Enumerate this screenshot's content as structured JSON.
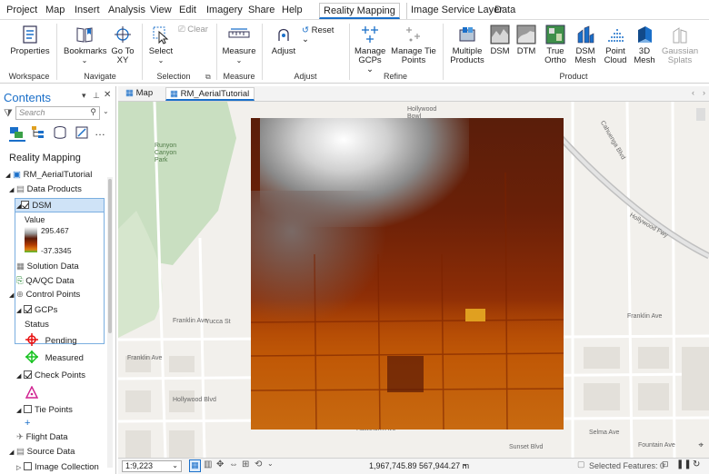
{
  "menu": {
    "tabs": [
      "Project",
      "Map",
      "Insert",
      "Analysis",
      "View",
      "Edit",
      "Imagery",
      "Share",
      "Help"
    ],
    "context_tab": "Reality Mapping",
    "extra_tabs": [
      "Image Service Layer",
      "Data"
    ]
  },
  "ribbon": {
    "workspace": {
      "group": "Workspace",
      "properties": "Properties"
    },
    "navigate": {
      "group": "Navigate",
      "bookmarks": "Bookmarks",
      "goto": "Go To XY"
    },
    "selection": {
      "group": "Selection",
      "select": "Select",
      "clear": "Clear"
    },
    "measure": {
      "group": "Measure",
      "measure": "Measure"
    },
    "adjust": {
      "group": "Adjust",
      "adjust": "Adjust",
      "reset": "Reset"
    },
    "refine": {
      "group": "Refine",
      "manage_gcps": "Manage GCPs",
      "manage_tie": "Manage Tie Points"
    },
    "product": {
      "group": "Product",
      "items": [
        "Multiple Products",
        "DSM",
        "DTM",
        "True Ortho",
        "DSM Mesh",
        "Point Cloud",
        "3D Mesh",
        "Gaussian Splats"
      ]
    }
  },
  "contents": {
    "title": "Contents",
    "search_placeholder": "Search",
    "heading": "Reality Mapping",
    "workspace": "RM_AerialTutorial",
    "data_products": "Data Products",
    "dsm": "DSM",
    "legend": {
      "label": "Value",
      "max": "295.467",
      "min": "-37.3345"
    },
    "solution_data": "Solution Data",
    "qaqc": "QA/QC Data",
    "control_points": "Control Points",
    "gcps": "GCPs",
    "status": "Status",
    "pending": "Pending",
    "measured": "Measured",
    "check_points": "Check Points",
    "tie_points": "Tie Points",
    "flight_data": "Flight Data",
    "source_data": "Source Data",
    "image_collection": "Image Collection"
  },
  "map": {
    "tabs": [
      "Map",
      "RM_AerialTutorial"
    ],
    "labels": [
      "Runyon Canyon Park",
      "Hollywood Bowl",
      "Franklin Ave",
      "Franklin Ave",
      "Hollywood Blvd",
      "Selma Ave",
      "Hawthorn Ave",
      "Fountain Ave",
      "Yucca St",
      "Sunset Blvd",
      "Franklin Ave",
      "Hollywood Fwy",
      "Cahuenga Blvd"
    ],
    "scale": "1:9,223",
    "coords": "1,967,745.89 567,944.27 m",
    "selected": "Selected Features: 0"
  },
  "colors": {
    "accent": "#1a6fc9",
    "pending": "#e81010",
    "measured": "#16c21f",
    "check": "#d02090"
  }
}
